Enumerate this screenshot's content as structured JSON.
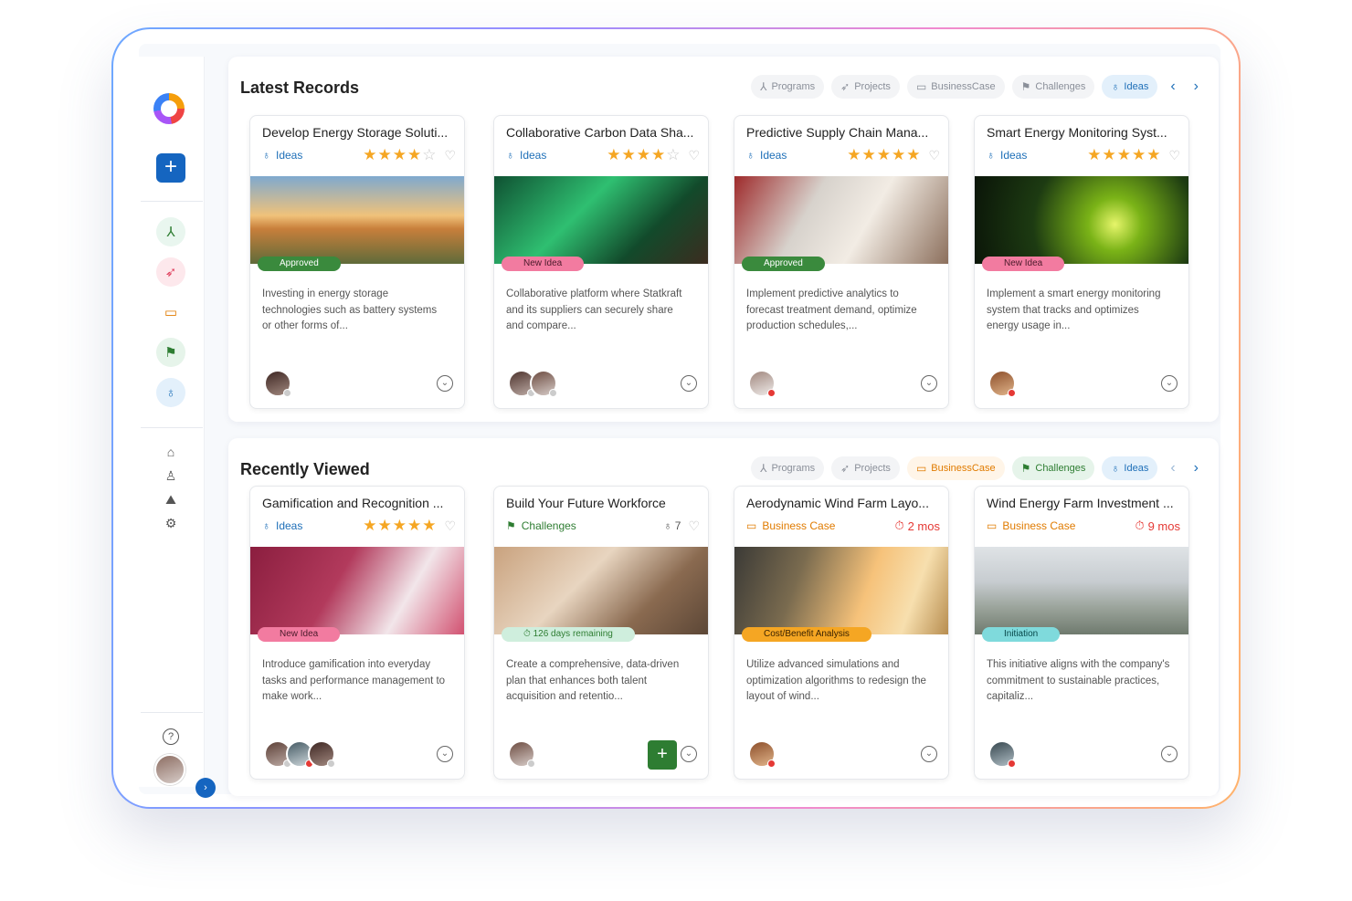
{
  "sidebar": {
    "add_label": "+",
    "icons": [
      "programs-icon",
      "projects-icon",
      "business-case-icon",
      "challenges-icon",
      "ideas-icon",
      "home-icon",
      "user-icon",
      "chart-icon",
      "settings-icon",
      "help-icon"
    ]
  },
  "latest": {
    "title": "Latest Records",
    "filters": [
      "Programs",
      "Projects",
      "BusinessCase",
      "Challenges",
      "Ideas"
    ],
    "cards": [
      {
        "title": "Develop Energy Storage Soluti...",
        "type": "Ideas",
        "stars": "★★★★",
        "badge": "Approved",
        "desc": "Investing in energy storage technologies such as battery systems or other forms of..."
      },
      {
        "title": "Collaborative Carbon Data Sha...",
        "type": "Ideas",
        "stars": "★★★★",
        "badge": "New Idea",
        "desc": "Collaborative platform where Statkraft and its suppliers can securely share and compare..."
      },
      {
        "title": "Predictive Supply Chain Mana...",
        "type": "Ideas",
        "stars": "★★★★★",
        "badge": "Approved",
        "desc": "Implement predictive analytics to forecast treatment demand, optimize production schedules,..."
      },
      {
        "title": "Smart Energy Monitoring Syst...",
        "type": "Ideas",
        "stars": "★★★★★",
        "badge": "New Idea",
        "desc": "Implement a smart energy monitoring system that tracks and optimizes energy usage in..."
      }
    ]
  },
  "recent": {
    "title": "Recently Viewed",
    "filters": [
      "Programs",
      "Projects",
      "BusinessCase",
      "Challenges",
      "Ideas"
    ],
    "cards": [
      {
        "title": "Gamification and Recognition ...",
        "type": "Ideas",
        "stars": "★★★★★",
        "badge": "New Idea",
        "desc": "Introduce gamification into everyday tasks and performance management to make work..."
      },
      {
        "title": "Build Your Future Workforce",
        "type": "Challenges",
        "count": "7",
        "badge": "126 days remaining",
        "desc": "Create a comprehensive, data-driven plan that enhances both talent acquisition and retentio..."
      },
      {
        "title": "Aerodynamic Wind Farm Layo...",
        "type": "Business Case",
        "time": "2 mos",
        "badge": "Cost/Benefit Analysis",
        "desc": "Utilize advanced simulations and optimization algorithms to redesign the layout of wind..."
      },
      {
        "title": "Wind Energy Farm Investment ...",
        "type": "Business Case",
        "time": "9 mos",
        "badge": "Initiation",
        "desc": "This initiative aligns with the company's commitment to sustainable practices, capitaliz..."
      }
    ]
  },
  "colors": {
    "primary": "#1565c0",
    "ideas": "#1e6fb8",
    "challenges": "#2e7d32",
    "business": "#e07b00",
    "star": "#f5a623",
    "approved": "#3a8a3d",
    "newidea": "#f27ba0"
  }
}
